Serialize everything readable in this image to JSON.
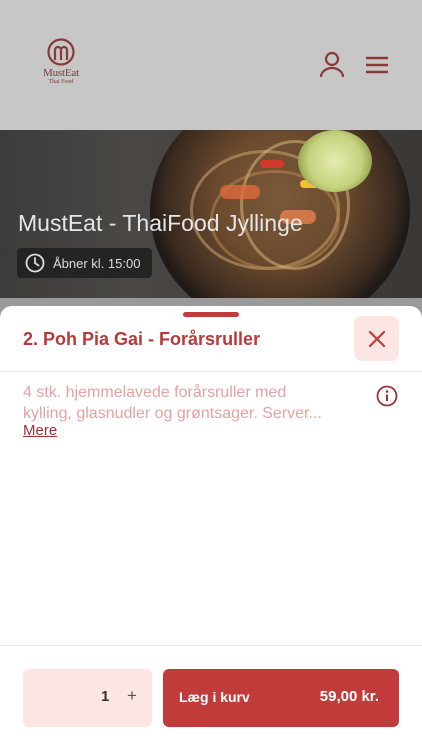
{
  "brand": {
    "name": "MustEat",
    "subtitle": "Thai Food"
  },
  "restaurant": {
    "title": "MustEat - ThaiFood Jyllinge",
    "hours": "Åbner kl. 15:00"
  },
  "product": {
    "title": "2. Poh Pia Gai - Forårsruller",
    "description_lines": [
      "4 stk. hjemmelavede forårsruller med",
      "kylling, glasnudler og grøntsager. Server..."
    ],
    "more_label": "Mere"
  },
  "cart": {
    "quantity": "1",
    "plus_label": "+",
    "add_label": "Læg i kurv",
    "price": "59,00 kr."
  },
  "colors": {
    "accent": "#c23b3b",
    "accent_light": "#fbe6e4",
    "description": "#e4a3a0"
  },
  "icons": [
    "musteat-logo-icon",
    "user-icon",
    "menu-icon",
    "clock-icon",
    "close-icon",
    "info-icon"
  ]
}
